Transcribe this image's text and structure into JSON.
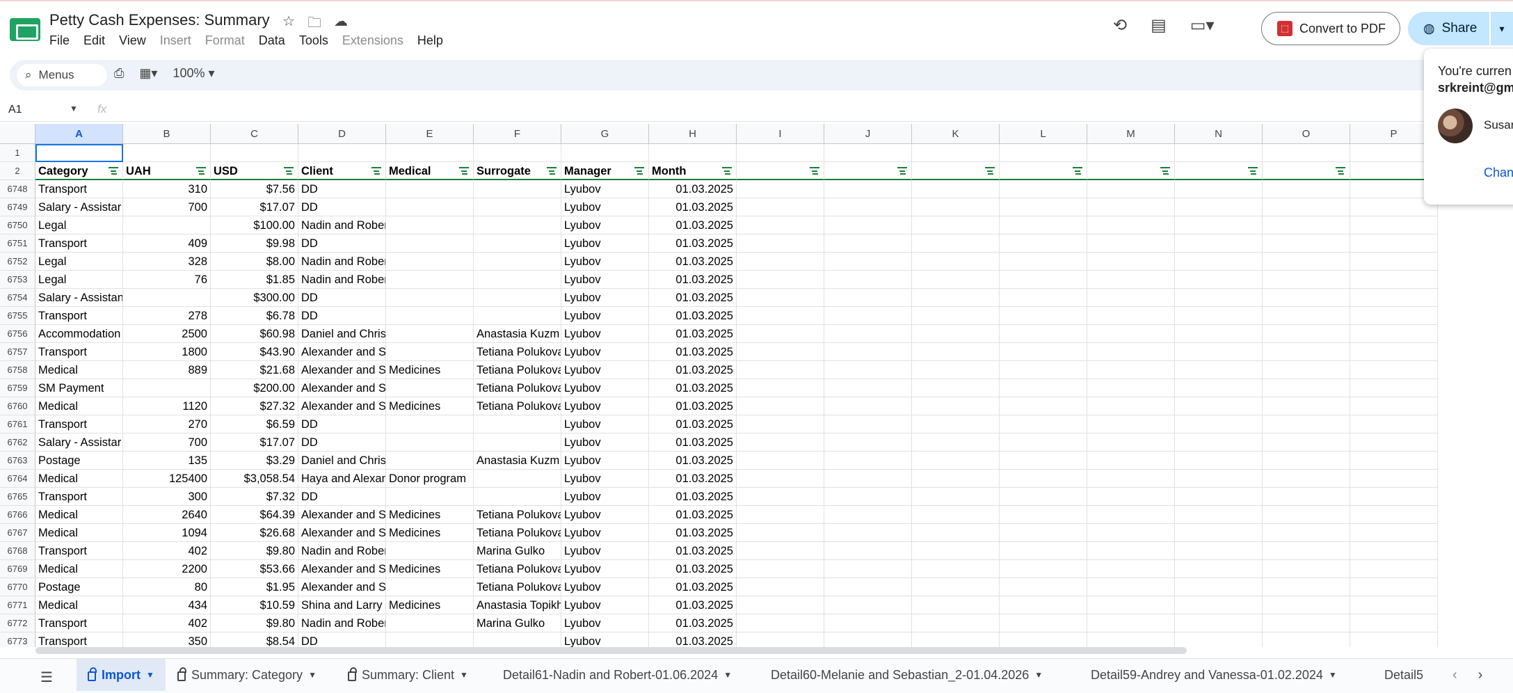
{
  "header": {
    "doc_title": "Petty Cash Expenses: Summary",
    "menus": [
      {
        "label": "File",
        "enabled": true
      },
      {
        "label": "Edit",
        "enabled": true
      },
      {
        "label": "View",
        "enabled": true
      },
      {
        "label": "Insert",
        "enabled": false
      },
      {
        "label": "Format",
        "enabled": false
      },
      {
        "label": "Data",
        "enabled": true
      },
      {
        "label": "Tools",
        "enabled": true
      },
      {
        "label": "Extensions",
        "enabled": false
      },
      {
        "label": "Help",
        "enabled": true
      }
    ],
    "convert_pdf_label": "Convert to PDF",
    "share_label": "Share"
  },
  "toolbar": {
    "search_label": "Menus",
    "zoom": "100%"
  },
  "formula_bar": {
    "cell_ref": "A1",
    "fx": "fx"
  },
  "columns": [
    "A",
    "B",
    "C",
    "D",
    "E",
    "F",
    "G",
    "H",
    "I",
    "J",
    "K",
    "L",
    "M",
    "N",
    "O",
    "P"
  ],
  "header_row": {
    "row_num": "2",
    "cells": [
      "Category",
      "UAH",
      "USD",
      "Client",
      "Medical",
      "Surrogate",
      "Manager",
      "Month"
    ]
  },
  "row1_num": "1",
  "rows": [
    {
      "n": "6748",
      "c": [
        "Transport",
        "310",
        "$7.56",
        "DD",
        "",
        "",
        "Lyubov",
        "01.03.2025"
      ]
    },
    {
      "n": "6749",
      "c": [
        "Salary - Assistar",
        "700",
        "$17.07",
        "DD",
        "",
        "",
        "Lyubov",
        "01.03.2025"
      ]
    },
    {
      "n": "6750",
      "c": [
        "Legal",
        "",
        "$100.00",
        "Nadin and Robert",
        "",
        "",
        "Lyubov",
        "01.03.2025"
      ]
    },
    {
      "n": "6751",
      "c": [
        "Transport",
        "409",
        "$9.98",
        "DD",
        "",
        "",
        "Lyubov",
        "01.03.2025"
      ]
    },
    {
      "n": "6752",
      "c": [
        "Legal",
        "328",
        "$8.00",
        "Nadin and Robert",
        "",
        "",
        "Lyubov",
        "01.03.2025"
      ]
    },
    {
      "n": "6753",
      "c": [
        "Legal",
        "76",
        "$1.85",
        "Nadin and Robert",
        "",
        "",
        "Lyubov",
        "01.03.2025"
      ]
    },
    {
      "n": "6754",
      "c": [
        "Salary - Assistant",
        "",
        "$300.00",
        "DD",
        "",
        "",
        "Lyubov",
        "01.03.2025"
      ]
    },
    {
      "n": "6755",
      "c": [
        "Transport",
        "278",
        "$6.78",
        "DD",
        "",
        "",
        "Lyubov",
        "01.03.2025"
      ]
    },
    {
      "n": "6756",
      "c": [
        "Accommodation",
        "2500",
        "$60.98",
        "Daniel and Christina",
        "",
        "Anastasia Kuzm",
        "Lyubov",
        "01.03.2025"
      ]
    },
    {
      "n": "6757",
      "c": [
        "Transport",
        "1800",
        "$43.90",
        "Alexander and Sandra",
        "",
        "Tetiana Polukova",
        "Lyubov",
        "01.03.2025"
      ]
    },
    {
      "n": "6758",
      "c": [
        "Medical",
        "889",
        "$21.68",
        "Alexander and S",
        "Medicines",
        "Tetiana Polukova",
        "Lyubov",
        "01.03.2025"
      ]
    },
    {
      "n": "6759",
      "c": [
        "SM Payment",
        "",
        "$200.00",
        "Alexander and Sandra",
        "",
        "Tetiana Polukova",
        "Lyubov",
        "01.03.2025"
      ]
    },
    {
      "n": "6760",
      "c": [
        "Medical",
        "1120",
        "$27.32",
        "Alexander and S",
        "Medicines",
        "Tetiana Polukova",
        "Lyubov",
        "01.03.2025"
      ]
    },
    {
      "n": "6761",
      "c": [
        "Transport",
        "270",
        "$6.59",
        "DD",
        "",
        "",
        "Lyubov",
        "01.03.2025"
      ]
    },
    {
      "n": "6762",
      "c": [
        "Salary - Assistar",
        "700",
        "$17.07",
        "DD",
        "",
        "",
        "Lyubov",
        "01.03.2025"
      ]
    },
    {
      "n": "6763",
      "c": [
        "Postage",
        "135",
        "$3.29",
        "Daniel and Christina",
        "",
        "Anastasia Kuzm",
        "Lyubov",
        "01.03.2025"
      ]
    },
    {
      "n": "6764",
      "c": [
        "Medical",
        "125400",
        "$3,058.54",
        "Haya and Alexan",
        "Donor program",
        "",
        "Lyubov",
        "01.03.2025"
      ]
    },
    {
      "n": "6765",
      "c": [
        "Transport",
        "300",
        "$7.32",
        "DD",
        "",
        "",
        "Lyubov",
        "01.03.2025"
      ]
    },
    {
      "n": "6766",
      "c": [
        "Medical",
        "2640",
        "$64.39",
        "Alexander and S",
        "Medicines",
        "Tetiana Polukova",
        "Lyubov",
        "01.03.2025"
      ]
    },
    {
      "n": "6767",
      "c": [
        "Medical",
        "1094",
        "$26.68",
        "Alexander and S",
        "Medicines",
        "Tetiana Polukova",
        "Lyubov",
        "01.03.2025"
      ]
    },
    {
      "n": "6768",
      "c": [
        "Transport",
        "402",
        "$9.80",
        "Nadin and Robert",
        "",
        "Marina Gulko",
        "Lyubov",
        "01.03.2025"
      ]
    },
    {
      "n": "6769",
      "c": [
        "Medical",
        "2200",
        "$53.66",
        "Alexander and S",
        "Medicines",
        "Tetiana Polukova",
        "Lyubov",
        "01.03.2025"
      ]
    },
    {
      "n": "6770",
      "c": [
        "Postage",
        "80",
        "$1.95",
        "Alexander and Sandra",
        "",
        "Tetiana Polukova",
        "Lyubov",
        "01.03.2025"
      ]
    },
    {
      "n": "6771",
      "c": [
        "Medical",
        "434",
        "$10.59",
        "Shina and Larry",
        "Medicines",
        "Anastasia Topikh",
        "Lyubov",
        "01.03.2025"
      ]
    },
    {
      "n": "6772",
      "c": [
        "Transport",
        "402",
        "$9.80",
        "Nadin and Robert",
        "",
        "Marina Gulko",
        "Lyubov",
        "01.03.2025"
      ]
    },
    {
      "n": "6773",
      "c": [
        "Transport",
        "350",
        "$8.54",
        "DD",
        "",
        "",
        "Lyubov",
        "01.03.2025"
      ]
    }
  ],
  "share_popup": {
    "line1": "You're curren",
    "line2": "srkreint@gm",
    "user": "Susar",
    "change": "Chan"
  },
  "tabs": [
    {
      "label": "Import",
      "locked": true,
      "active": true
    },
    {
      "label": "Summary:  Category",
      "locked": true,
      "active": false
    },
    {
      "label": "Summary: Client",
      "locked": true,
      "active": false
    },
    {
      "label": "Detail61-Nadin and Robert-01.06.2024",
      "locked": false,
      "active": false
    },
    {
      "label": "Detail60-Melanie and Sebastian_2-01.04.2026",
      "locked": false,
      "active": false
    },
    {
      "label": "Detail59-Andrey and Vanessa-01.02.2024",
      "locked": false,
      "active": false
    },
    {
      "label": "Detail5",
      "locked": false,
      "active": false
    }
  ]
}
